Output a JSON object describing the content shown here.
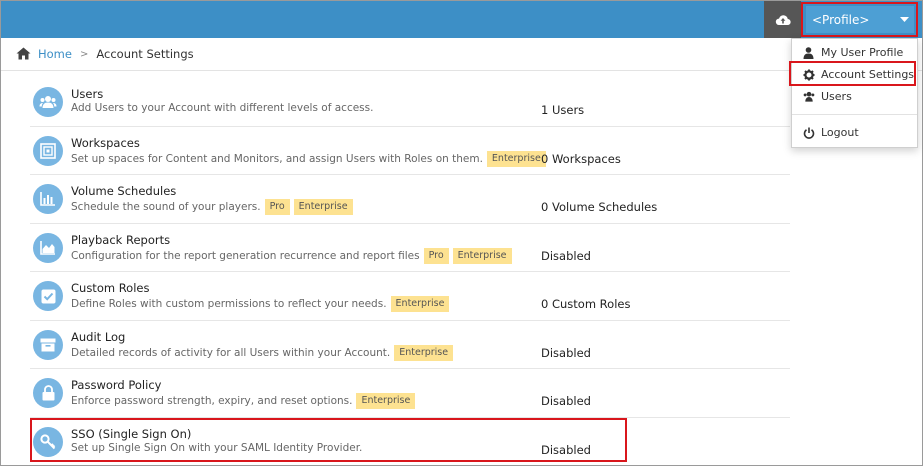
{
  "header": {
    "profile_label": "<Profile>",
    "upload_icon": "cloud-upload-icon",
    "caret_icon": "caret-down-icon"
  },
  "breadcrumb": {
    "home": "Home",
    "separator": ">",
    "current": "Account Settings"
  },
  "settings": [
    {
      "title": "Users",
      "description": "Add Users to your Account with different levels of access.",
      "badges": [],
      "value": "1 Users",
      "icon": "users-icon"
    },
    {
      "title": "Workspaces",
      "description": "Set up spaces for Content and Monitors, and assign Users with Roles on them.",
      "badges": [
        "Enterprise"
      ],
      "value": "0 Workspaces",
      "icon": "workspaces-icon"
    },
    {
      "title": "Volume Schedules",
      "description": "Schedule the sound of your players.",
      "badges": [
        "Pro",
        "Enterprise"
      ],
      "value": "0 Volume Schedules",
      "icon": "bar-chart-icon"
    },
    {
      "title": "Playback Reports",
      "description": "Configuration for the report generation recurrence and report files",
      "badges": [
        "Pro",
        "Enterprise"
      ],
      "value": "Disabled",
      "icon": "area-chart-icon"
    },
    {
      "title": "Custom Roles",
      "description": "Define Roles with custom permissions to reflect your needs.",
      "badges": [
        "Enterprise"
      ],
      "value": "0 Custom Roles",
      "icon": "checkbox-icon"
    },
    {
      "title": "Audit Log",
      "description": "Detailed records of activity for all Users within your Account.",
      "badges": [
        "Enterprise"
      ],
      "value": "Disabled",
      "icon": "archive-icon"
    },
    {
      "title": "Password Policy",
      "description": "Enforce password strength, expiry, and reset options.",
      "badges": [
        "Enterprise"
      ],
      "value": "Disabled",
      "icon": "lock-icon"
    },
    {
      "title": "SSO (Single Sign On)",
      "description": "Set up Single Sign On with your SAML Identity Provider.",
      "badges": [],
      "value": "Disabled",
      "icon": "key-icon"
    }
  ],
  "dropdown": {
    "items": [
      {
        "label": "My User Profile",
        "icon": "user-icon"
      },
      {
        "label": "Account Settings",
        "icon": "gear-icon"
      },
      {
        "label": "Users",
        "icon": "users-icon"
      },
      {
        "label": "Logout",
        "icon": "power-icon"
      }
    ]
  },
  "colors": {
    "topbar": "#3d8fc6",
    "icon_circle": "#79b6e2",
    "badge": "#fde291",
    "highlight": "#d9161c"
  }
}
